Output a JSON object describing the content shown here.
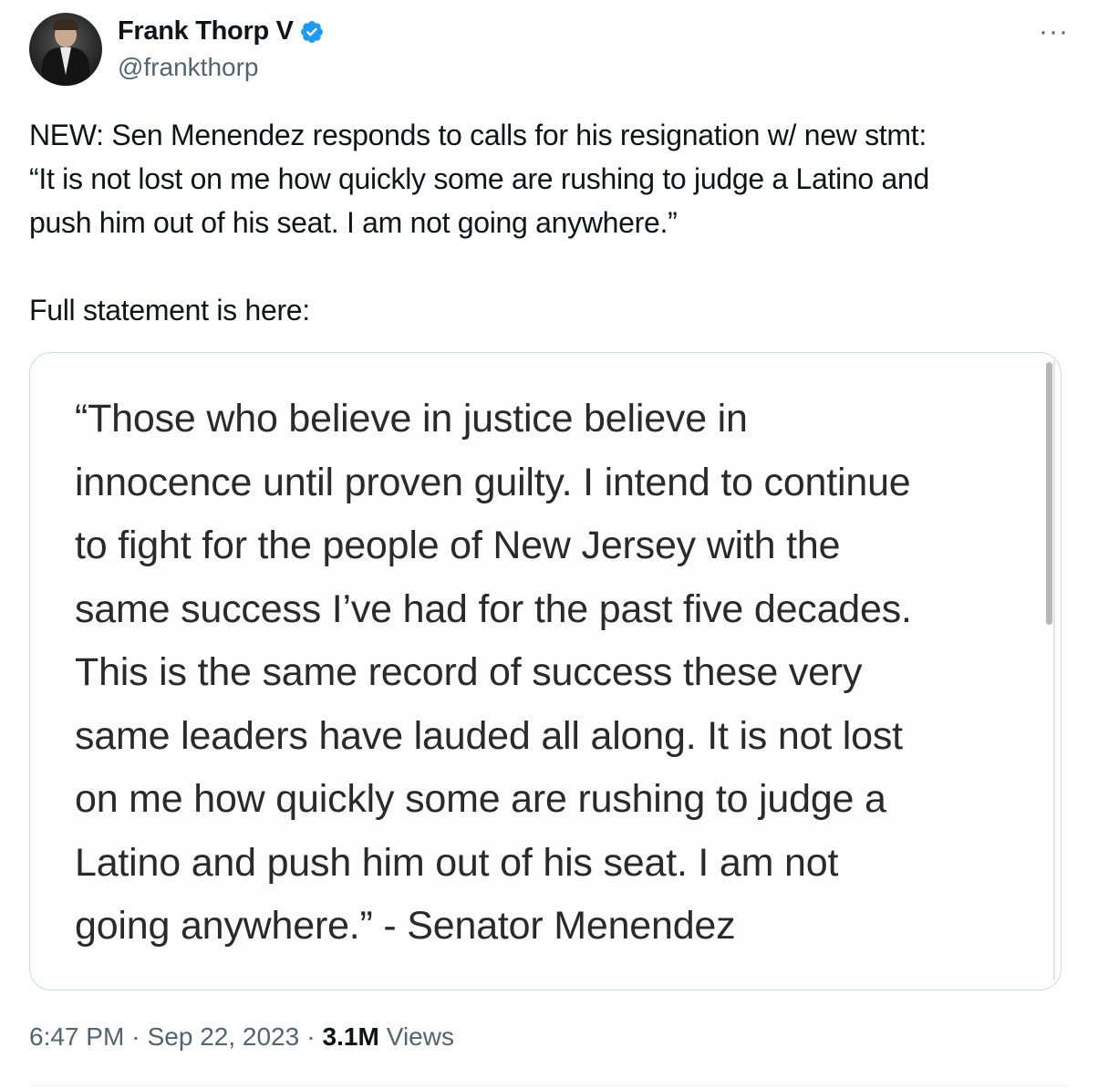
{
  "author": {
    "display_name": "Frank Thorp V",
    "handle": "@frankthorp",
    "verified": true,
    "avatar_icon": "profile-photo",
    "verified_color": "#1d9bf0"
  },
  "more_options": "···",
  "tweet": {
    "line1": "NEW: Sen Menendez responds to calls for his resignation w/ new stmt:\n“It is not lost on me how quickly some are rushing to judge a Latino and\npush him out of his seat. I am not going anywhere.”",
    "line2": "Full statement is here:"
  },
  "media": {
    "quote": "“Those who believe in justice believe in\ninnocence until proven guilty. I intend to continue\nto fight for the people of New Jersey with the\nsame success I’ve had for the past five decades.\nThis is the same record of success these very\nsame leaders have lauded all along. It is not lost\non me how quickly some are rushing to judge a\nLatino and push him out of his seat. I am not\ngoing anywhere.” - Senator Menendez"
  },
  "meta": {
    "time": "6:47 PM",
    "date": "Sep 22, 2023",
    "separator": "·",
    "views_count": "3.1M",
    "views_label": "Views"
  }
}
